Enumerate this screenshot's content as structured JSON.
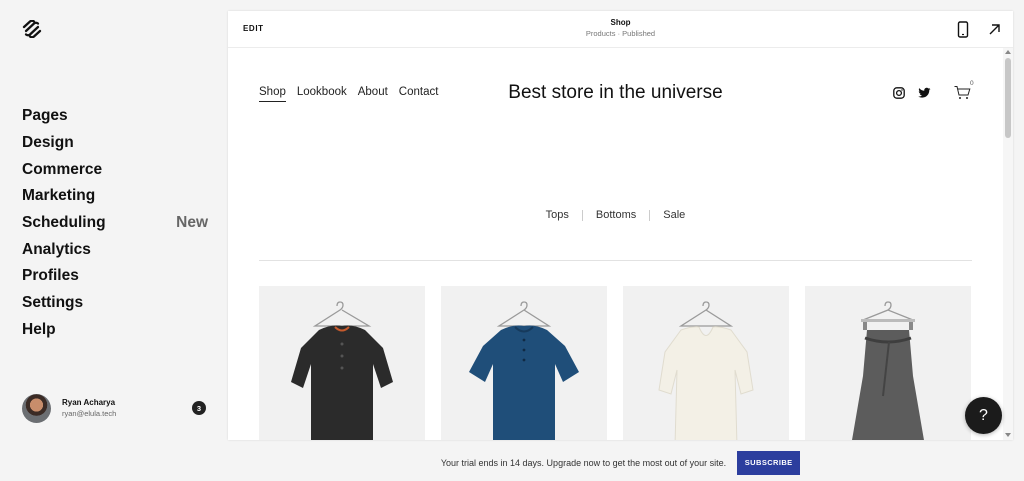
{
  "sidebar": {
    "logo": "squarespace-logo",
    "items": [
      {
        "label": "Pages",
        "badge": ""
      },
      {
        "label": "Design",
        "badge": ""
      },
      {
        "label": "Commerce",
        "badge": ""
      },
      {
        "label": "Marketing",
        "badge": ""
      },
      {
        "label": "Scheduling",
        "badge": "New"
      },
      {
        "label": "Analytics",
        "badge": ""
      },
      {
        "label": "Profiles",
        "badge": ""
      },
      {
        "label": "Settings",
        "badge": ""
      },
      {
        "label": "Help",
        "badge": ""
      }
    ],
    "user": {
      "name": "Ryan Acharya",
      "email": "ryan@elula.tech",
      "notifications": "3"
    }
  },
  "editor": {
    "edit_label": "EDIT",
    "page_title": "Shop",
    "page_status": "Products · Published",
    "icons": [
      "mobile-preview-icon",
      "open-external-icon"
    ]
  },
  "site": {
    "nav": [
      {
        "label": "Shop",
        "active": true
      },
      {
        "label": "Lookbook",
        "active": false
      },
      {
        "label": "About",
        "active": false
      },
      {
        "label": "Contact",
        "active": false
      }
    ],
    "title": "Best store in the universe",
    "cart_count": "0",
    "categories": [
      "Tops",
      "Bottoms",
      "Sale"
    ],
    "products": [
      {
        "name": "black-linen-shirt",
        "color": "#2b2b2b"
      },
      {
        "name": "blue-linen-shirt",
        "color": "#1f4e79"
      },
      {
        "name": "white-linen-top",
        "color": "#f3f0e6"
      },
      {
        "name": "grey-wrap-skirt",
        "color": "#5c5c5c"
      }
    ]
  },
  "help_button": "?",
  "trial": {
    "text": "Your trial ends in 14 days. Upgrade now to get the most out of your site.",
    "button": "SUBSCRIBE",
    "button_color": "#2c3e9e"
  }
}
